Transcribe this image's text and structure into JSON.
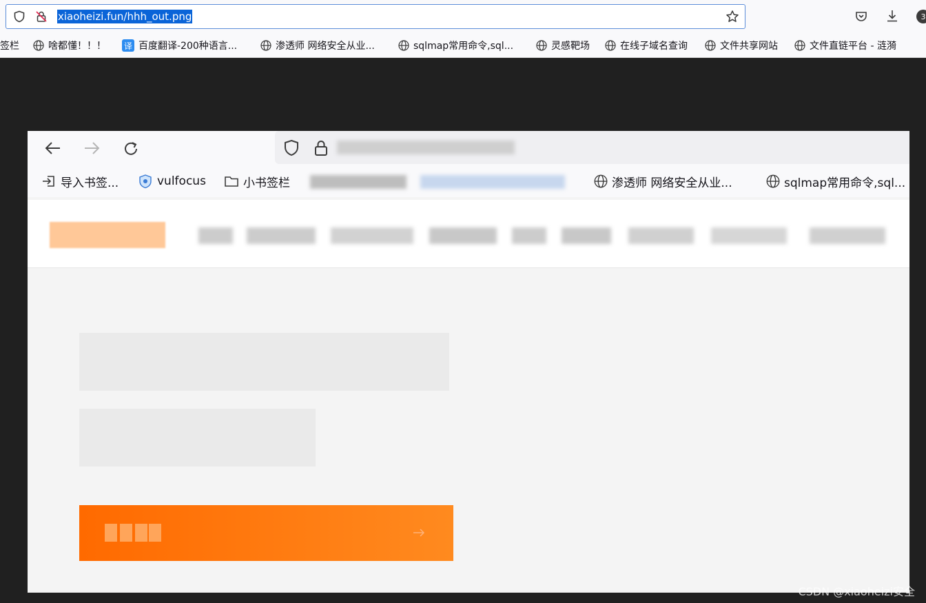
{
  "browser": {
    "url": "xiaoheizi.fun/hhh_out.png",
    "tab_count_badge": "3",
    "bookmarks": [
      {
        "label": "签栏"
      },
      {
        "label": "啥都懂！！！"
      },
      {
        "label": "百度翻译-200种语言..."
      },
      {
        "label": "渗透师 网络安全从业..."
      },
      {
        "label": "sqlmap常用命令,sql..."
      },
      {
        "label": "灵感靶场"
      },
      {
        "label": "在线子域名查询"
      },
      {
        "label": "文件共享网站"
      },
      {
        "label": "文件直链平台 - 涟漪"
      }
    ]
  },
  "inner_browser": {
    "bookmarks": [
      {
        "label": "导入书签..."
      },
      {
        "label": "vulfocus"
      },
      {
        "label": "小书签栏"
      },
      {
        "label": "渗透师 网络安全从业..."
      },
      {
        "label": "sqlmap常用命令,sql..."
      }
    ]
  },
  "watermark": "CSDN @xiaoheizi安全",
  "colors": {
    "accent_orange": "#ff6a00",
    "url_highlight": "#0a64d8"
  }
}
